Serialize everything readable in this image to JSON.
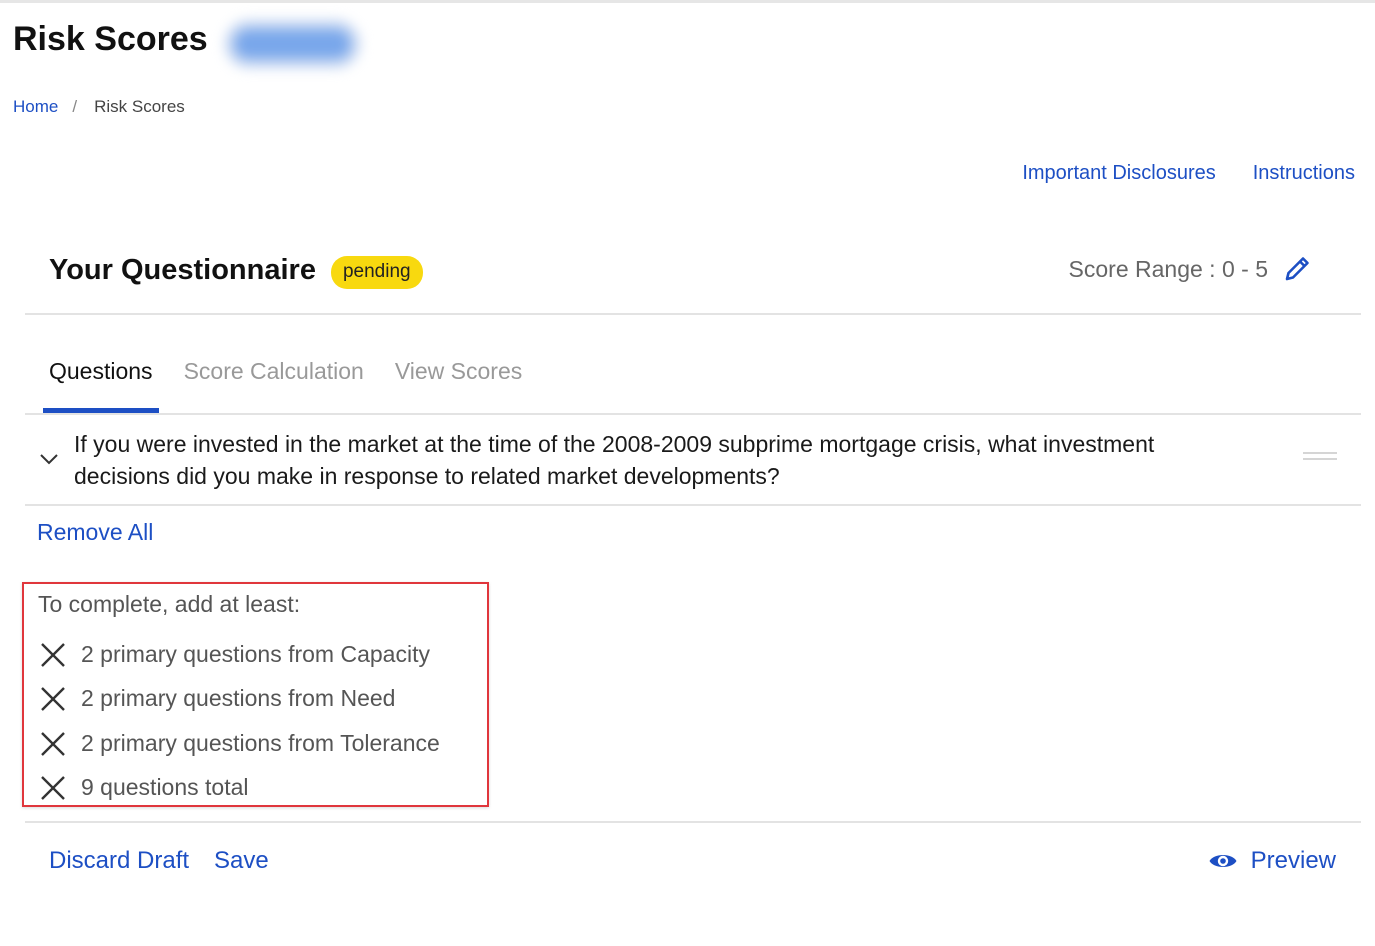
{
  "header": {
    "title": "Risk Scores"
  },
  "breadcrumb": {
    "home": "Home",
    "separator": "/",
    "current": "Risk Scores"
  },
  "top_links": {
    "disclosures": "Important Disclosures",
    "instructions": "Instructions"
  },
  "questionnaire": {
    "title": "Your Questionnaire",
    "status": "pending",
    "score_range": "Score Range : 0 - 5"
  },
  "tabs": [
    {
      "label": "Questions",
      "active": true
    },
    {
      "label": "Score Calculation",
      "active": false
    },
    {
      "label": "View Scores",
      "active": false
    }
  ],
  "question": {
    "text": "If you were invested in the market at the time of the 2008-2009 subprime mortgage crisis, what investment decisions did you make in response to related market developments?"
  },
  "actions": {
    "remove_all": "Remove All",
    "discard_draft": "Discard Draft",
    "save": "Save",
    "preview": "Preview"
  },
  "requirements": {
    "title": "To complete, add at least:",
    "items": [
      "2 primary questions from Capacity",
      "2 primary questions from Need",
      "2 primary questions from Tolerance",
      "9 questions total"
    ]
  },
  "colors": {
    "accent": "#1d4fc4",
    "badge": "#f8d90f",
    "alert_border": "#e0363c"
  },
  "icons": {
    "edit": "pencil-icon",
    "collapse": "chevron-down-icon",
    "drag": "drag-handle-icon",
    "unmet": "x-icon",
    "preview": "eye-icon"
  }
}
